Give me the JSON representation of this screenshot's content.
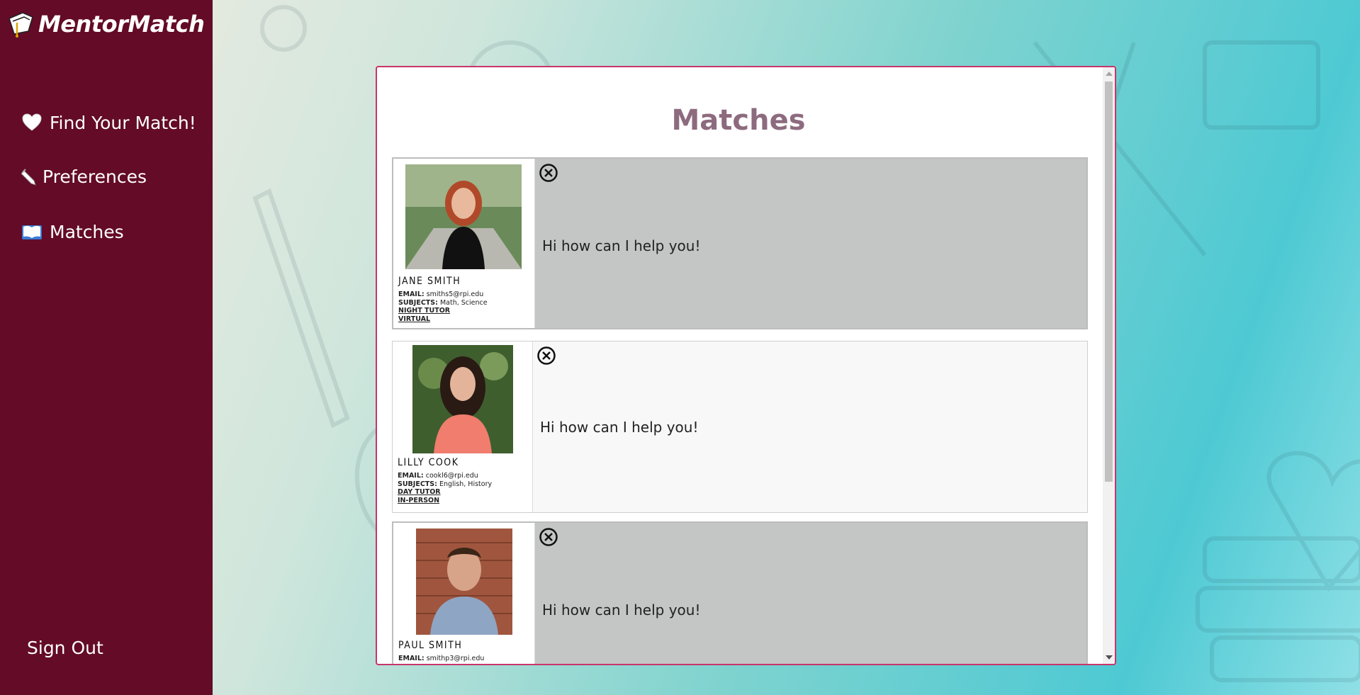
{
  "app": {
    "name": "MentorMatch"
  },
  "nav": {
    "items": [
      {
        "label": "Find Your Match!",
        "icon": "heart-icon"
      },
      {
        "label": "Preferences",
        "icon": "pencil-icon"
      },
      {
        "label": "Matches",
        "icon": "book-icon"
      }
    ],
    "signout": "Sign Out"
  },
  "panel": {
    "title": "Matches"
  },
  "matches": [
    {
      "name": "JANE SMITH",
      "email_label": "EMAIL:",
      "email": "smiths5@rpi.edu",
      "subjects_label": "SUBJECTS:",
      "subjects": "Math, Science",
      "time": "NIGHT TUTOR",
      "mode": "VIRTUAL",
      "message": "Hi how can I help you!"
    },
    {
      "name": "LILLY COOK",
      "email_label": "EMAIL:",
      "email": "cookl6@rpi.edu",
      "subjects_label": "SUBJECTS:",
      "subjects": "English, History",
      "time": "DAY TUTOR",
      "mode": "IN-PERSON",
      "message": "Hi how can I help you!"
    },
    {
      "name": "PAUL SMITH",
      "email_label": "EMAIL:",
      "email": "smithp3@rpi.edu",
      "message": "Hi how can I help you!"
    }
  ],
  "colors": {
    "sidebar": "#630b27",
    "panel_border": "#c8356b",
    "title": "#8d6b7e",
    "card_dark": "#c4c5c5",
    "card_light": "#f8f8f8"
  }
}
